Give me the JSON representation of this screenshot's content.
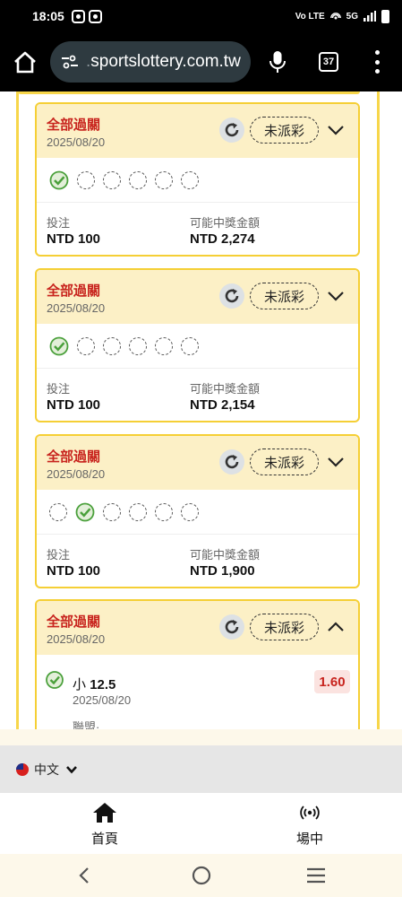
{
  "status_bar": {
    "time": "18:05",
    "signal_text": "5G"
  },
  "browser": {
    "url_prefix": ".",
    "url_host": "sportslottery.com.tw",
    "tab_count": "37"
  },
  "bets": [
    {
      "title": "全部過關",
      "date": "2025/08/20",
      "status": "未派彩",
      "legs": [
        "win",
        "pending",
        "pending",
        "pending",
        "pending",
        "pending"
      ],
      "stake_label": "投注",
      "stake": "NTD 100",
      "payout_label": "可能中獎金額",
      "payout": "NTD 2,274",
      "expanded": false
    },
    {
      "title": "全部過關",
      "date": "2025/08/20",
      "status": "未派彩",
      "legs": [
        "win",
        "pending",
        "pending",
        "pending",
        "pending",
        "pending"
      ],
      "stake_label": "投注",
      "stake": "NTD 100",
      "payout_label": "可能中獎金額",
      "payout": "NTD 2,154",
      "expanded": false
    },
    {
      "title": "全部過關",
      "date": "2025/08/20",
      "status": "未派彩",
      "legs": [
        "pending",
        "win",
        "pending",
        "pending",
        "pending",
        "pending"
      ],
      "stake_label": "投注",
      "stake": "NTD 100",
      "payout_label": "可能中獎金額",
      "payout": "NTD 1,900",
      "expanded": false
    },
    {
      "title": "全部過關",
      "date": "2025/08/20",
      "status": "未派彩",
      "expanded": true,
      "detail": {
        "pick_prefix": "小",
        "pick_value": "12.5",
        "date": "2025/08/20",
        "odds": "1.60",
        "note": "聯盟·"
      }
    }
  ],
  "language": {
    "label": "中文"
  },
  "bottom_nav": [
    {
      "label": "首頁",
      "icon": "home-icon"
    },
    {
      "label": "場中",
      "icon": "live-broadcast-icon"
    }
  ],
  "colors": {
    "accent_red": "#c8241e",
    "card_border": "#f5cf35",
    "card_header": "#fcf0c6",
    "win_green": "#4aa03b"
  }
}
